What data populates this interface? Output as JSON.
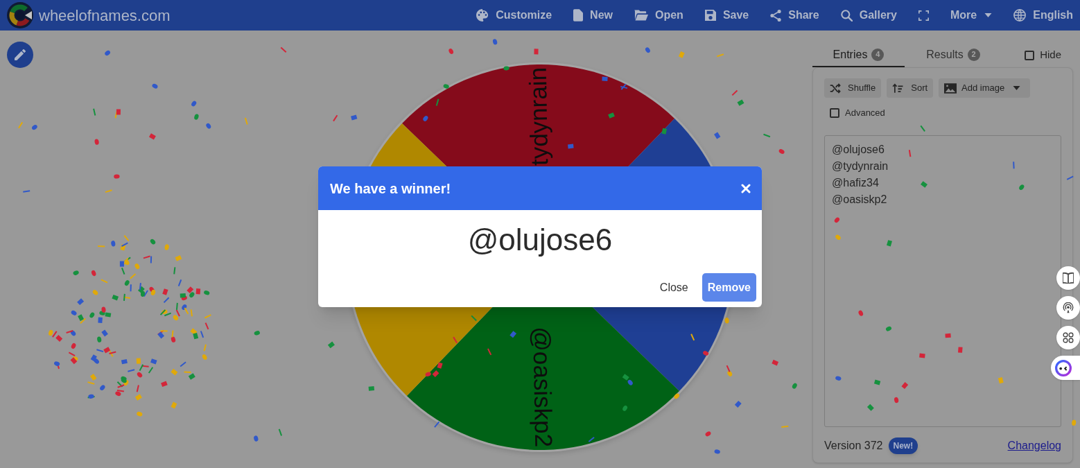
{
  "nav": {
    "brand": "wheelofnames.com",
    "items": [
      {
        "kind": "link",
        "label": "Customize"
      },
      {
        "kind": "link",
        "label": "New"
      },
      {
        "kind": "link",
        "label": "Open"
      },
      {
        "kind": "link",
        "label": "Save"
      },
      {
        "kind": "link",
        "label": "Share"
      },
      {
        "kind": "link",
        "label": "Gallery"
      },
      {
        "kind": "icon"
      },
      {
        "kind": "menu",
        "label": "More"
      },
      {
        "kind": "link",
        "label": "English"
      }
    ]
  },
  "wheel": {
    "segments": [
      {
        "color": "#850b1b",
        "label": "tydynrain"
      },
      {
        "color": "#1f3f94"
      },
      {
        "color": "#006216",
        "label": "@oasiskp2"
      },
      {
        "color": "#b08800"
      }
    ]
  },
  "panel": {
    "tabs": [
      {
        "label": "Entries",
        "count": "4",
        "selected": true
      },
      {
        "label": "Results",
        "count": "2",
        "selected": false
      }
    ],
    "hide": {
      "label": "Hide",
      "checked": false
    },
    "toolbar": [
      {
        "kind": "button",
        "label": "Shuffle"
      },
      {
        "kind": "button",
        "label": "Sort"
      },
      {
        "kind": "dropdown",
        "label": "Add image"
      }
    ],
    "advanced": {
      "label": "Advanced",
      "checked": false
    },
    "entries": [
      "@olujose6",
      "@tydynrain",
      "@hafiz34",
      "@oasiskp2"
    ],
    "footer": {
      "version": "Version 372",
      "badge": "New!",
      "link": "Changelog"
    }
  },
  "dialog": {
    "title": "We have a winner!",
    "winner": "@olujose6",
    "buttons": [
      {
        "kind": "text",
        "label": "Close"
      },
      {
        "kind": "primary",
        "label": "Remove"
      }
    ]
  }
}
